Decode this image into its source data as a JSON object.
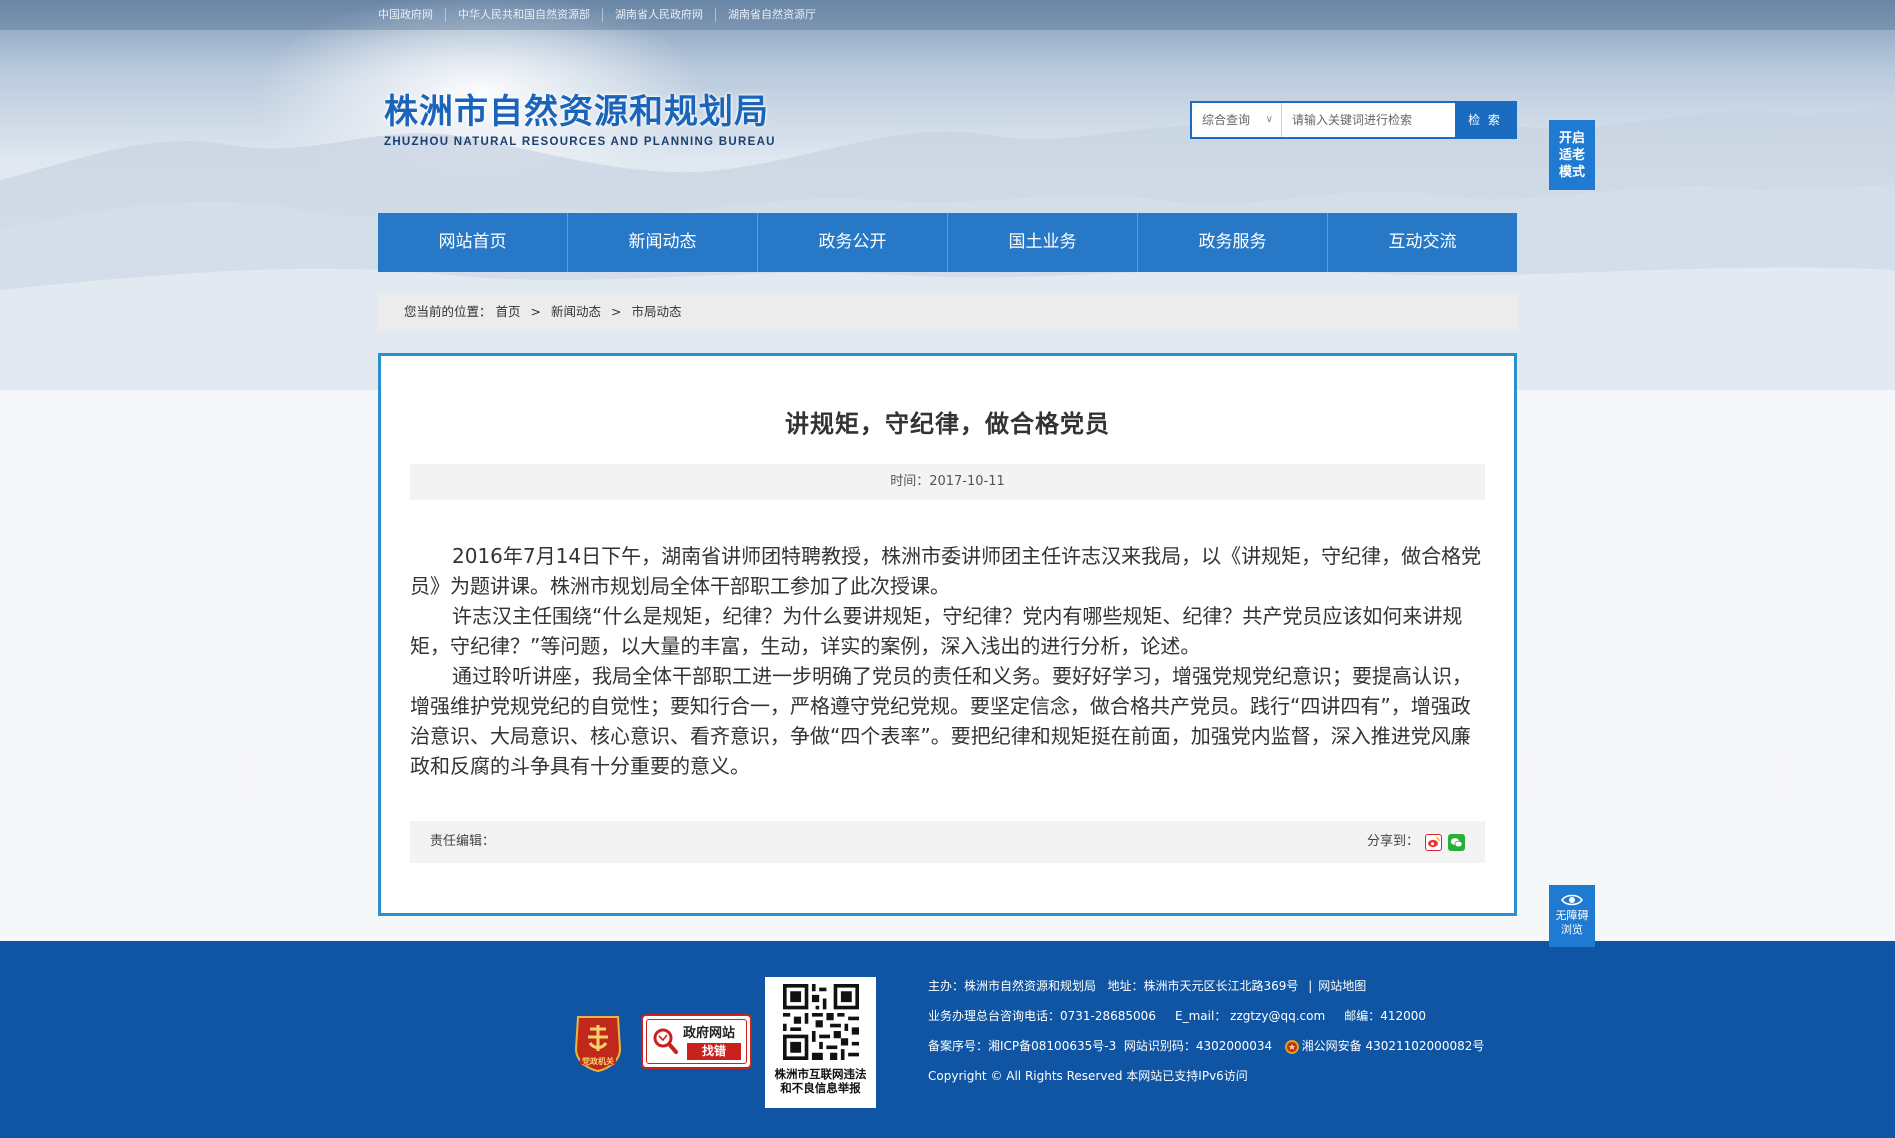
{
  "top_links": [
    "中国政府网",
    "中华人民共和国自然资源部",
    "湖南省人民政府网",
    "湖南省自然资源厅"
  ],
  "logo": {
    "cn": "株洲市自然资源和规划局",
    "en": "ZHUZHOU NATURAL RESOURCES AND PLANNING BUREAU"
  },
  "search": {
    "scope": "综合查询",
    "placeholder": "请输入关键词进行检索",
    "button": "检 索"
  },
  "side": {
    "elderly": "开启适老模式",
    "access": "无障碍浏览"
  },
  "nav": [
    "网站首页",
    "新闻动态",
    "政务公开",
    "国土业务",
    "政务服务",
    "互动交流"
  ],
  "breadcrumb": {
    "prefix": "您当前的位置：",
    "items": [
      "首页",
      "新闻动态",
      "市局动态"
    ],
    "separator": ">"
  },
  "article": {
    "title": "讲规矩，守纪律，做合格党员",
    "time_label": "时间：",
    "date": "2017-10-11",
    "paragraphs": [
      "2016年7月14日下午，湖南省讲师团特聘教授，株洲市委讲师团主任许志汉来我局，以《讲规矩，守纪律，做合格党员》为题讲课。株洲市规划局全体干部职工参加了此次授课。",
      "许志汉主任围绕“什么是规矩，纪律？为什么要讲规矩，守纪律？党内有哪些规矩、纪律？共产党员应该如何来讲规矩，守纪律？”等问题，以大量的丰富，生动，详实的案例，深入浅出的进行分析，论述。",
      "通过聆听讲座，我局全体干部职工进一步明确了党员的责任和义务。要好好学习，增强党规党纪意识；要提高认识，增强维护党规党纪的自觉性；要知行合一，严格遵守党纪党规。要坚定信念，做合格共产党员。践行“四讲四有”，增强政治意识、大局意识、核心意识、看齐意识，争做“四个表率”。要把纪律和规矩挺在前面，加强党内监督，深入推进党风廉政和反腐的斗争具有十分重要的意义。"
    ],
    "editor_label": "责任编辑：",
    "share_label": "分享到："
  },
  "footer": {
    "party_badge": "党政机关",
    "gov_badge_top": "政府网站",
    "gov_badge_bottom": "找错",
    "qr_caption_1": "株洲市互联网违法",
    "qr_caption_2": "和不良信息举报",
    "sponsor": "主办：株洲市自然资源和规划局",
    "address": "地址：株洲市天元区长江北路369号",
    "sitemap": "网站地图",
    "phone": "业务办理总台咨询电话：0731-28685006",
    "email": "E_mail：  zzgtzy@qq.com",
    "postcode": "邮编：412000",
    "icp": "备案序号：湘ICP备08100635号-3",
    "site_id": "网站识别码：4302000034",
    "police": "湘公网安备 43021102000082号",
    "copyright": "Copyright © All Rights Reserved 本网站已支持IPv6访问"
  },
  "colors": {
    "nav_blue": "#2878c8",
    "footer_blue": "#0f55a4",
    "card_border": "#2b90d0",
    "side_button": "#1f7bd1"
  }
}
